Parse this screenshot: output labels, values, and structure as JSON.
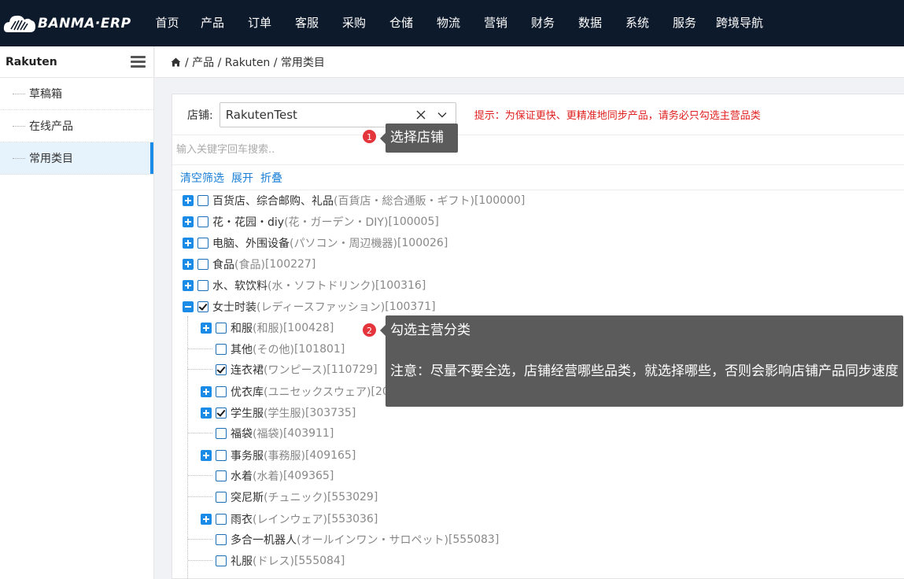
{
  "brand": {
    "logo_text": "BANMA·ERP"
  },
  "nav": {
    "items": [
      "首页",
      "产品",
      "订单",
      "客服",
      "采购",
      "仓储",
      "物流",
      "营销",
      "财务",
      "数据",
      "系统",
      "服务",
      "跨境导航"
    ]
  },
  "sidebar": {
    "title": "Rakuten",
    "items": [
      {
        "label": "草稿箱",
        "active": false
      },
      {
        "label": "在线产品",
        "active": false
      },
      {
        "label": "常用类目",
        "active": true
      }
    ]
  },
  "breadcrumb": {
    "path": "/ 产品 / Rakuten / 常用类目"
  },
  "filter": {
    "store_label": "店铺:",
    "store_value": "RakutenTest",
    "hint": "提示：为保证更快、更精准地同步产品，请务必只勾选主营品类",
    "search_placeholder": "输入关键字回车搜索..",
    "actions": [
      "清空筛选",
      "展开",
      "折叠"
    ]
  },
  "tree": [
    {
      "level": 0,
      "expander": "plus",
      "checked": false,
      "name": "百货店、综合邮购、礼品",
      "jp": "(百貨店・総合通販・ギフト)",
      "code": "[100000]"
    },
    {
      "level": 0,
      "expander": "plus",
      "checked": false,
      "name": "花・花园・diy",
      "jp": "(花・ガーデン・DIY)",
      "code": "[100005]"
    },
    {
      "level": 0,
      "expander": "plus",
      "checked": false,
      "name": "电脑、外围设备",
      "jp": "(パソコン・周辺機器)",
      "code": "[100026]"
    },
    {
      "level": 0,
      "expander": "plus",
      "checked": false,
      "name": "食品",
      "jp": "(食品)",
      "code": "[100227]"
    },
    {
      "level": 0,
      "expander": "plus",
      "checked": false,
      "name": "水、软饮料",
      "jp": "(水・ソフトドリンク)",
      "code": "[100316]"
    },
    {
      "level": 0,
      "expander": "minus",
      "checked": true,
      "name": "女士时装",
      "jp": "(レディースファッション)",
      "code": "[100371]"
    },
    {
      "level": 1,
      "expander": "plus",
      "checked": false,
      "name": "和服",
      "jp": "(和服)",
      "code": "[100428]"
    },
    {
      "level": 1,
      "expander": "none",
      "checked": false,
      "name": "其他",
      "jp": "(その他)",
      "code": "[101801]"
    },
    {
      "level": 1,
      "expander": "none",
      "checked": true,
      "name": "连衣裙",
      "jp": "(ワンピース)",
      "code": "[110729]"
    },
    {
      "level": 1,
      "expander": "plus",
      "checked": false,
      "name": "优衣库",
      "jp": "(ユニセックスウェア)",
      "code": "[20"
    },
    {
      "level": 1,
      "expander": "plus",
      "checked": true,
      "name": "学生服",
      "jp": "(学生服)",
      "code": "[303735]"
    },
    {
      "level": 1,
      "expander": "none",
      "checked": false,
      "name": "福袋",
      "jp": "(福袋)",
      "code": "[403911]"
    },
    {
      "level": 1,
      "expander": "plus",
      "checked": false,
      "name": "事务服",
      "jp": "(事務服)",
      "code": "[409165]"
    },
    {
      "level": 1,
      "expander": "none",
      "checked": false,
      "name": "水着",
      "jp": "(水着)",
      "code": "[409365]"
    },
    {
      "level": 1,
      "expander": "none",
      "checked": false,
      "name": "突尼斯",
      "jp": "(チュニック)",
      "code": "[553029]"
    },
    {
      "level": 1,
      "expander": "plus",
      "checked": false,
      "name": "雨衣",
      "jp": "(レインウェア)",
      "code": "[553036]"
    },
    {
      "level": 1,
      "expander": "none",
      "checked": false,
      "name": "多合一机器人",
      "jp": "(オールインワン・サロペット)",
      "code": "[555083]"
    },
    {
      "level": 1,
      "expander": "none",
      "checked": false,
      "name": "礼服",
      "jp": "(ドレス)",
      "code": "[555084]"
    }
  ],
  "tooltips": {
    "step1": {
      "number": "1",
      "text": "选择店铺"
    },
    "step2": {
      "number": "2",
      "title": "勾选主营分类",
      "note": "注意：尽量不要全选，店铺经营哪些品类，就选择哪些，否则会影响店铺产品同步速度"
    }
  }
}
